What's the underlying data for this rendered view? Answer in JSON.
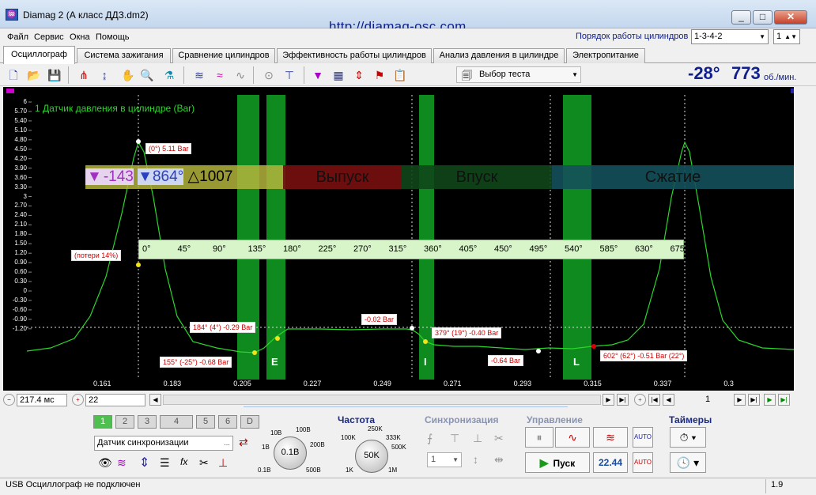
{
  "window": {
    "title": "Diamag 2 (А класс ДДЗ.dm2)",
    "url": "http://diamag-osc.com",
    "minimize": "_",
    "maximize": "□",
    "close": "✕"
  },
  "menu": [
    "Файл",
    "Сервис",
    "Окна",
    "Помощь"
  ],
  "cylinders": {
    "label": "Порядок работы цилиндров",
    "order": "1-3-4-2",
    "count": "1"
  },
  "tabs": [
    "Осциллограф",
    "Система зажигания",
    "Сравнение цилиндров",
    "Эффективность работы цилиндров",
    "Анализ давления в цилиндре",
    "Электропитание"
  ],
  "toolbar": {
    "test_select": "Выбор теста",
    "angle": "-28°",
    "rpm": "773",
    "rpm_unit": "об./мин."
  },
  "scope": {
    "channel": "1 Датчик давления в цилиндре (Bar)",
    "y_ticks": [
      "6",
      "5.70",
      "5.40",
      "5.10",
      "4.80",
      "4.50",
      "4.20",
      "3.90",
      "3.60",
      "3.30",
      "3",
      "2.70",
      "2.40",
      "2.10",
      "1.80",
      "1.50",
      "1.20",
      "0.90",
      "0.60",
      "0.30",
      "0",
      "-0.30",
      "-0.60",
      "-0.90",
      "-1.20"
    ],
    "x_ticks": [
      "0.161",
      "0.183",
      "0.205",
      "0.227",
      "0.249",
      "0.271",
      "0.293",
      "0.315",
      "0.337",
      "0.3"
    ],
    "degrees": [
      "0°",
      "45°",
      "90°",
      "135°",
      "180°",
      "225°",
      "270°",
      "315°",
      "360°",
      "405°",
      "450°",
      "495°",
      "540°",
      "585°",
      "630°",
      "675°"
    ],
    "phases": [
      "Выпуск",
      "Впуск",
      "Сжатие"
    ],
    "measure": {
      "m1": "-143",
      "m2": "864°",
      "delta": "1007"
    },
    "markers": [
      "E",
      "I",
      "L"
    ],
    "tags": [
      "(0°) 5.11 Bar",
      "(потери 14%)",
      "184° (4°) -0.29 Bar",
      "155° (-25°) -0.68 Bar",
      "-0.02 Bar",
      "379° (19°) -0.40 Bar",
      "-0.64 Bar",
      "602° (62°) -0.51 Bar (22°)"
    ]
  },
  "nav": {
    "timebase": "217.4 мс",
    "zoom": "22",
    "page": "1"
  },
  "panel": {
    "channels": [
      "1",
      "2",
      "3",
      "4",
      "5",
      "6",
      "D"
    ],
    "sensor": "Датчик синхронизации",
    "amp_knob": "0.1B",
    "amp_labels": [
      "10B",
      "100B",
      "1B",
      "200B",
      "0.1B",
      "500B"
    ],
    "freq_title": "Частота",
    "freq_knob": "50K",
    "freq_labels": [
      "250K",
      "100K",
      "333K",
      "500K",
      "1K",
      "1M"
    ],
    "sync_title": "Синхронизация",
    "sync_channel": "1",
    "control_title": "Управление",
    "start": "Пуск",
    "speed": "22.44",
    "timers_title": "Таймеры"
  },
  "status": {
    "text": "USB Осциллограф не подключен",
    "version": "1.9"
  },
  "colors": {
    "trace": "#2bd62b",
    "bands": "#0e8a1e",
    "accent": "#10208c"
  }
}
